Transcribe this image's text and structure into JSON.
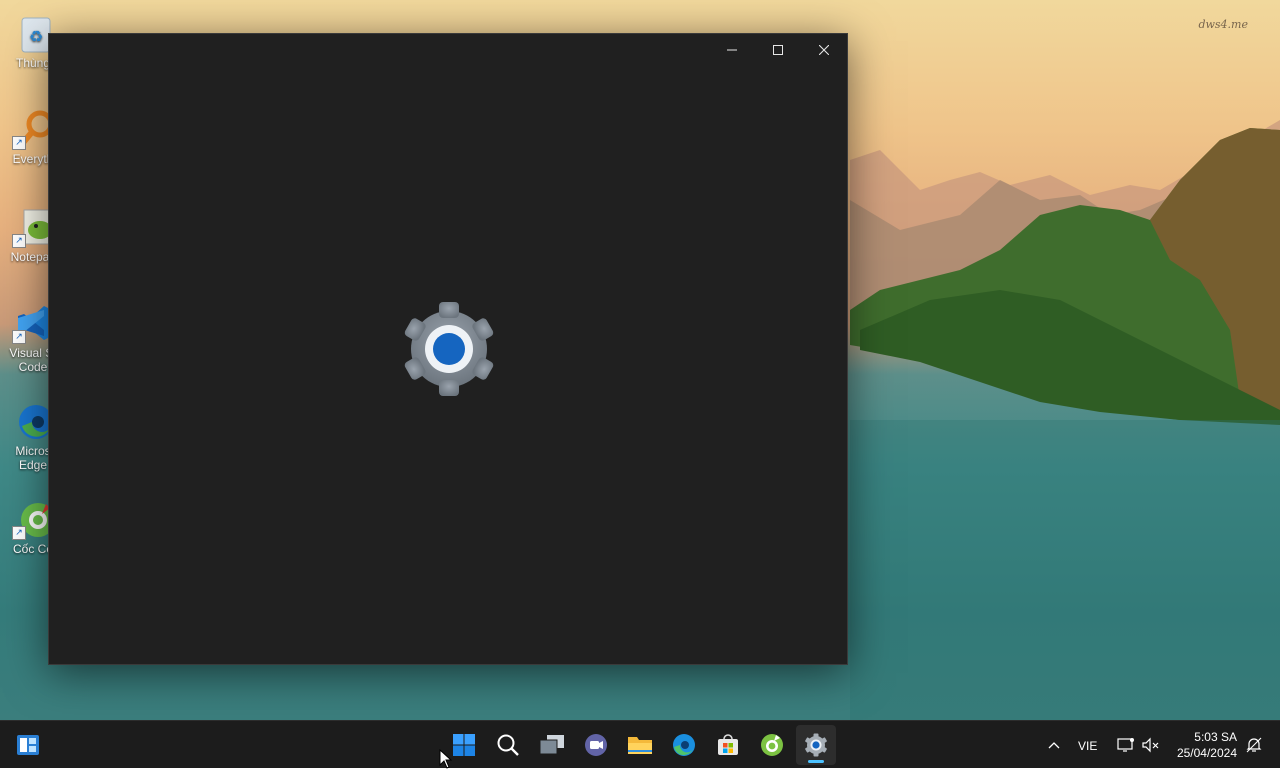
{
  "desktop": {
    "watermark": "dws4.me",
    "icons": [
      {
        "label": "Thùng",
        "icon": "recycle-bin-icon"
      },
      {
        "label": "Everyth",
        "icon": "everything-search-icon"
      },
      {
        "label": "Notepac",
        "icon": "notepad-plus-plus-icon"
      },
      {
        "label": "Visual St",
        "label2": "Code",
        "icon": "vscode-icon"
      },
      {
        "label": "Micros",
        "label2": "Edge",
        "icon": "edge-icon"
      },
      {
        "label": "Cốc Cố",
        "icon": "coccoc-icon"
      }
    ]
  },
  "window": {
    "app": "settings-icon",
    "controls": [
      "minimize",
      "maximize",
      "close"
    ],
    "background": "#202020",
    "accent": "#1565c0"
  },
  "taskbar": {
    "apps": [
      "widgets-icon",
      "start-icon",
      "search-icon",
      "task-view-icon",
      "teams-chat-icon",
      "file-explorer-icon",
      "edge-icon",
      "store-icon",
      "coccoc-icon",
      "settings-icon"
    ],
    "active_app": "settings-icon",
    "tray": {
      "language": "VIE",
      "time": "5:03 SA",
      "date": "25/04/2024"
    }
  }
}
